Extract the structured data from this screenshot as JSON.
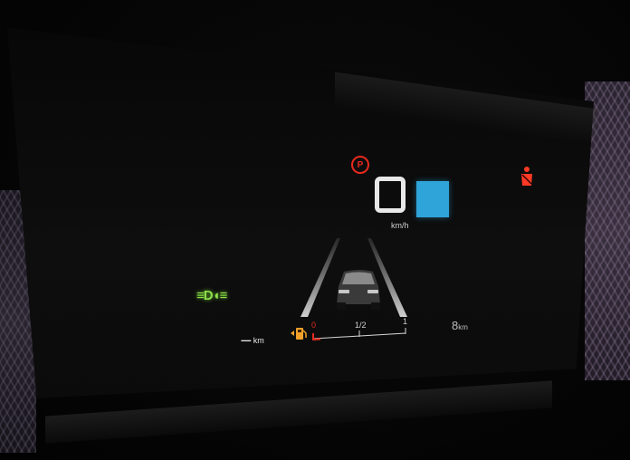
{
  "cluster": {
    "speed_unit": "km/h",
    "parking_brake_symbol": "P",
    "seatbelt_icon": "seatbelt-warning-icon",
    "lights_icon": "headlights-icon",
    "fuel_icon": "fuel-pump-icon",
    "car_icon": "vehicle-rear-icon",
    "left_range": "----",
    "left_range_unit": "km",
    "gauge_empty_label": "0",
    "gauge_half_label": "1/2",
    "gauge_full_label": "1",
    "right_value": "8",
    "right_value_unit": "km",
    "colors": {
      "warning_red": "#e52a1e",
      "speed_limit_blue": "#2ea4d8",
      "headlights_green": "#8ee04a",
      "fuel_orange": "#f2a02a"
    }
  }
}
